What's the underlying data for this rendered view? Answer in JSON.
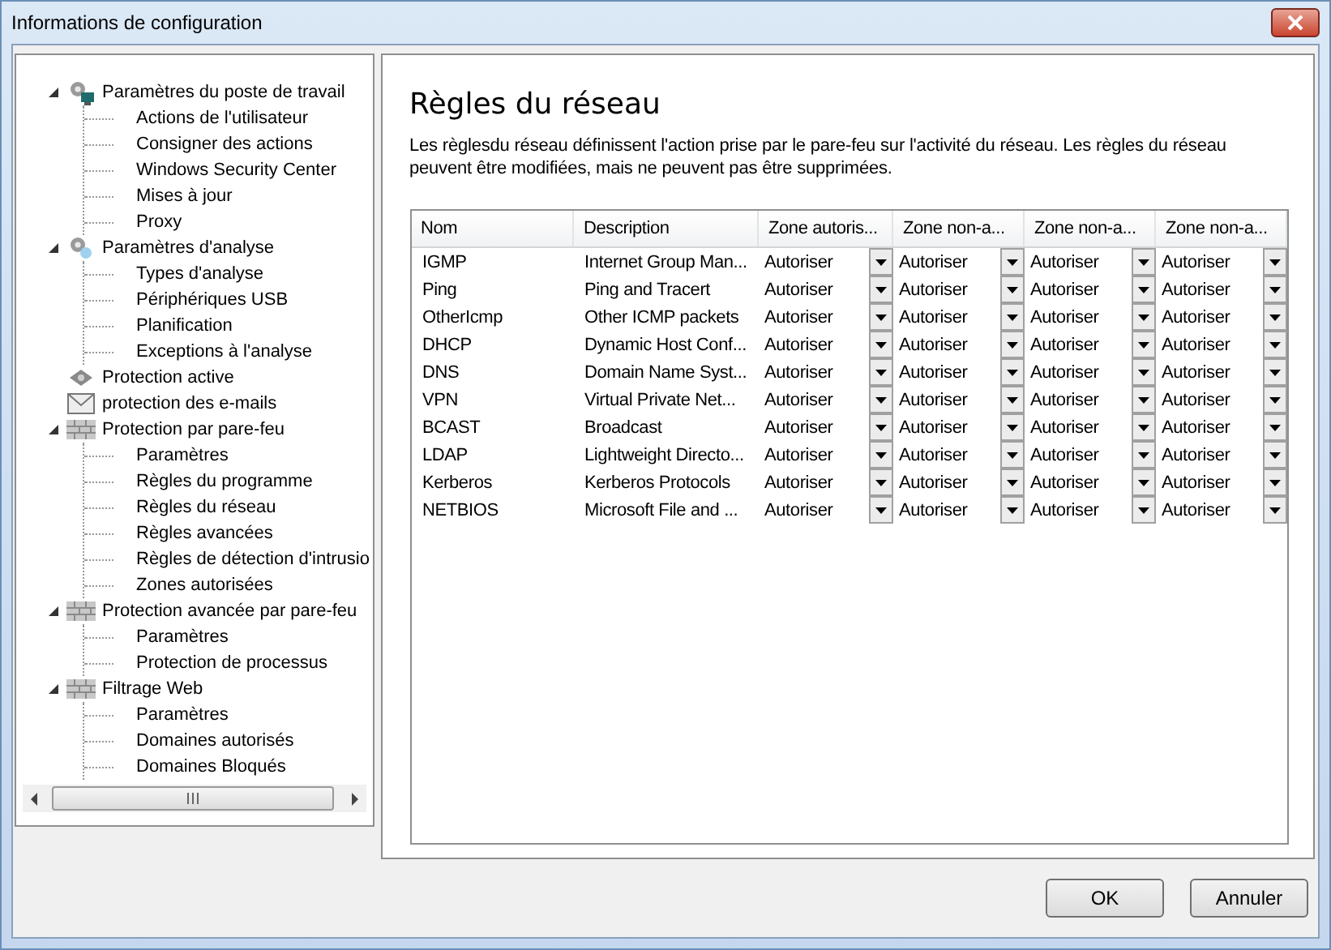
{
  "window": {
    "title": "Informations de configuration"
  },
  "tree": [
    {
      "label": "Paramètres du poste de travail",
      "kind": "workstation",
      "expanded": true,
      "children": [
        {
          "label": "Actions de l'utilisateur"
        },
        {
          "label": "Consigner des actions"
        },
        {
          "label": "Windows Security Center"
        },
        {
          "label": "Mises à jour"
        },
        {
          "label": "Proxy"
        }
      ]
    },
    {
      "label": "Paramètres d'analyse",
      "kind": "scan",
      "expanded": true,
      "children": [
        {
          "label": "Types d'analyse"
        },
        {
          "label": "Périphériques USB"
        },
        {
          "label": "Planification"
        },
        {
          "label": "Exceptions à l'analyse"
        }
      ]
    },
    {
      "label": "Protection active",
      "kind": "active"
    },
    {
      "label": "protection des e-mails",
      "kind": "mail"
    },
    {
      "label": "Protection par pare-feu",
      "kind": "firewall",
      "expanded": true,
      "children": [
        {
          "label": "Paramètres"
        },
        {
          "label": "Règles du programme"
        },
        {
          "label": "Règles du réseau"
        },
        {
          "label": "Règles avancées"
        },
        {
          "label": "Règles de détection d'intrusio"
        },
        {
          "label": "Zones autorisées"
        }
      ]
    },
    {
      "label": "Protection avancée par pare-feu",
      "kind": "firewall",
      "expanded": true,
      "children": [
        {
          "label": "Paramètres"
        },
        {
          "label": "Protection de processus"
        }
      ]
    },
    {
      "label": "Filtrage Web",
      "kind": "firewall",
      "expanded": true,
      "children": [
        {
          "label": "Paramètres"
        },
        {
          "label": "Domaines autorisés"
        },
        {
          "label": "Domaines Bloqués"
        }
      ]
    }
  ],
  "page": {
    "title": "Règles du réseau",
    "description": "Les règlesdu réseau  définissent l'action prise par le pare-feu sur l'activité du réseau. Les règles du réseau peuvent être modifiées, mais ne peuvent pas être supprimées."
  },
  "table": {
    "columns": [
      "Nom",
      "Description",
      "Zone autoris...",
      "Zone non-a...",
      "Zone non-a...",
      "Zone non-a..."
    ],
    "rows": [
      {
        "name": "IGMP",
        "description": "Internet Group Man...",
        "zones": [
          "Autoriser",
          "Autoriser",
          "Autoriser",
          "Autoriser"
        ]
      },
      {
        "name": "Ping",
        "description": "Ping and Tracert",
        "zones": [
          "Autoriser",
          "Autoriser",
          "Autoriser",
          "Autoriser"
        ]
      },
      {
        "name": "OtherIcmp",
        "description": "Other ICMP packets",
        "zones": [
          "Autoriser",
          "Autoriser",
          "Autoriser",
          "Autoriser"
        ]
      },
      {
        "name": "DHCP",
        "description": "Dynamic Host Conf...",
        "zones": [
          "Autoriser",
          "Autoriser",
          "Autoriser",
          "Autoriser"
        ]
      },
      {
        "name": "DNS",
        "description": "Domain Name Syst...",
        "zones": [
          "Autoriser",
          "Autoriser",
          "Autoriser",
          "Autoriser"
        ]
      },
      {
        "name": "VPN",
        "description": "Virtual Private Net...",
        "zones": [
          "Autoriser",
          "Autoriser",
          "Autoriser",
          "Autoriser"
        ]
      },
      {
        "name": "BCAST",
        "description": "Broadcast",
        "zones": [
          "Autoriser",
          "Autoriser",
          "Autoriser",
          "Autoriser"
        ]
      },
      {
        "name": "LDAP",
        "description": "Lightweight Directo...",
        "zones": [
          "Autoriser",
          "Autoriser",
          "Autoriser",
          "Autoriser"
        ]
      },
      {
        "name": "Kerberos",
        "description": "Kerberos Protocols",
        "zones": [
          "Autoriser",
          "Autoriser",
          "Autoriser",
          "Autoriser"
        ]
      },
      {
        "name": "NETBIOS",
        "description": "Microsoft File and ...",
        "zones": [
          "Autoriser",
          "Autoriser",
          "Autoriser",
          "Autoriser"
        ]
      }
    ]
  },
  "buttons": [
    "OK",
    "Annuler"
  ]
}
